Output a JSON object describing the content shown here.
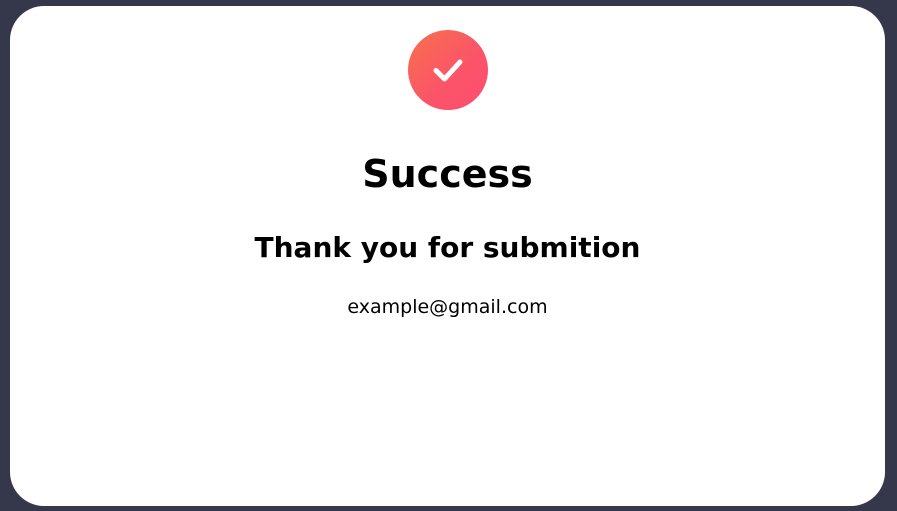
{
  "card": {
    "status_icon": "check-icon",
    "title": "Success",
    "message": "Thank you for submition",
    "email": "example@gmail.com"
  },
  "colors": {
    "background": "#35374b",
    "card": "#ffffff",
    "badge_gradient_start": "#f7714a",
    "badge_gradient_end": "#fd4c70",
    "text": "#000000"
  }
}
